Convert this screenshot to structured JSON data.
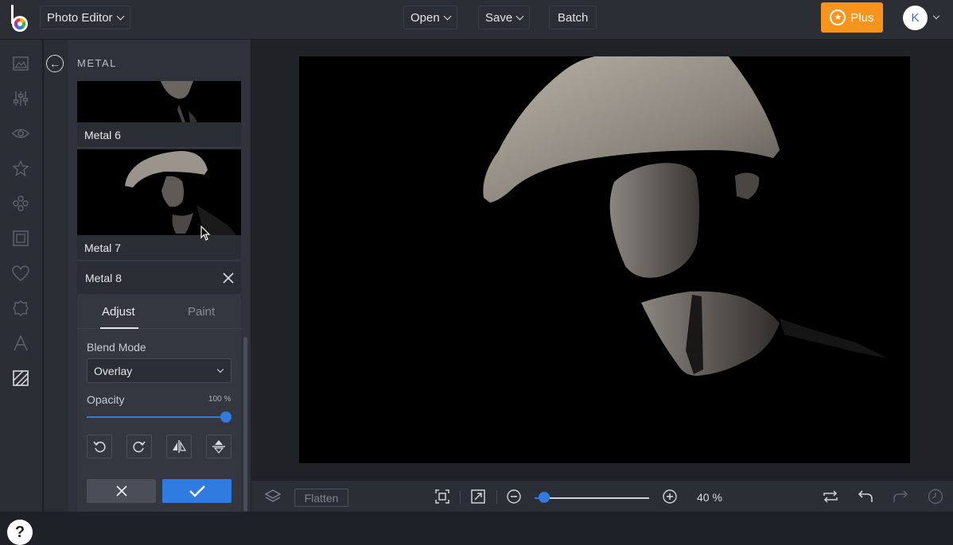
{
  "topbar": {
    "app_menu": "Photo Editor",
    "open": "Open",
    "save": "Save",
    "batch": "Batch",
    "plus": "Plus",
    "avatar_initial": "K"
  },
  "sidebar_icons": [
    "image-icon",
    "sliders-icon",
    "eye-icon",
    "star-icon",
    "sticker-icon",
    "frame-icon",
    "heart-icon",
    "badge-icon",
    "text-icon",
    "texture-icon"
  ],
  "panel": {
    "title": "METAL",
    "thumbs": [
      {
        "label": "Metal 6"
      },
      {
        "label": "Metal 7"
      }
    ],
    "editor": {
      "name": "Metal 8",
      "tabs": [
        "Adjust",
        "Paint"
      ],
      "active_tab": "Adjust",
      "blend_label": "Blend Mode",
      "blend_value": "Overlay",
      "opacity_label": "Opacity",
      "opacity_value": "100 %",
      "opacity": 1.0
    }
  },
  "bottombar": {
    "flatten": "Flatten",
    "zoom": "40 %",
    "zoom_fraction": 0.08
  },
  "colors": {
    "accent": "#2f7be0",
    "plus": "#f7941d"
  }
}
